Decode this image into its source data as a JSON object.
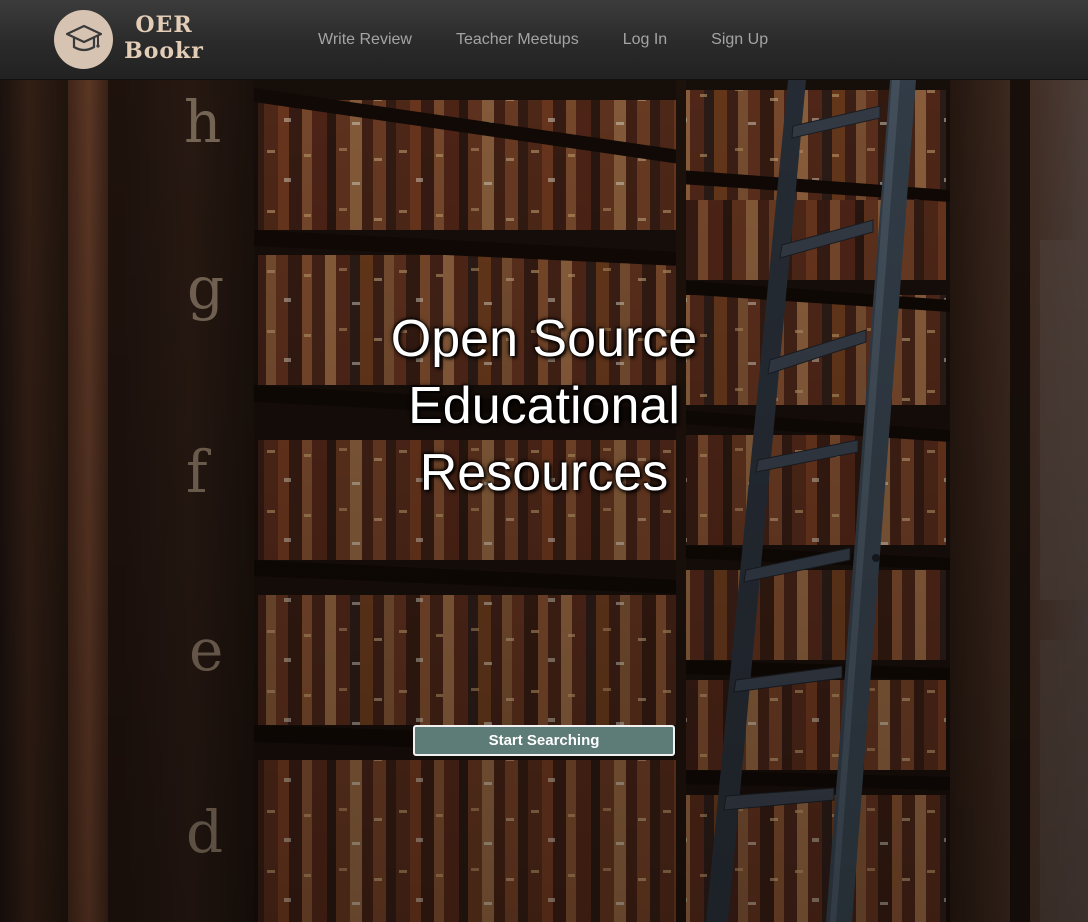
{
  "brand": {
    "line1": "OER",
    "line2": "Bookr",
    "icon": "graduation-cap-icon",
    "circle_color": "#d6c3b2",
    "text_color": "#e3cdb7"
  },
  "nav": {
    "items": [
      {
        "label": "Write Review"
      },
      {
        "label": "Teacher Meetups"
      },
      {
        "label": "Log In"
      },
      {
        "label": "Sign Up"
      }
    ]
  },
  "hero": {
    "title_lines": [
      "Open Source",
      "Educational",
      "Resources"
    ],
    "cta_label": "Start Searching",
    "cta_color": "#5d7b77",
    "background": "library-bookshelves-with-ladder",
    "shelf_letters": [
      "h",
      "g",
      "f",
      "e",
      "d"
    ]
  }
}
